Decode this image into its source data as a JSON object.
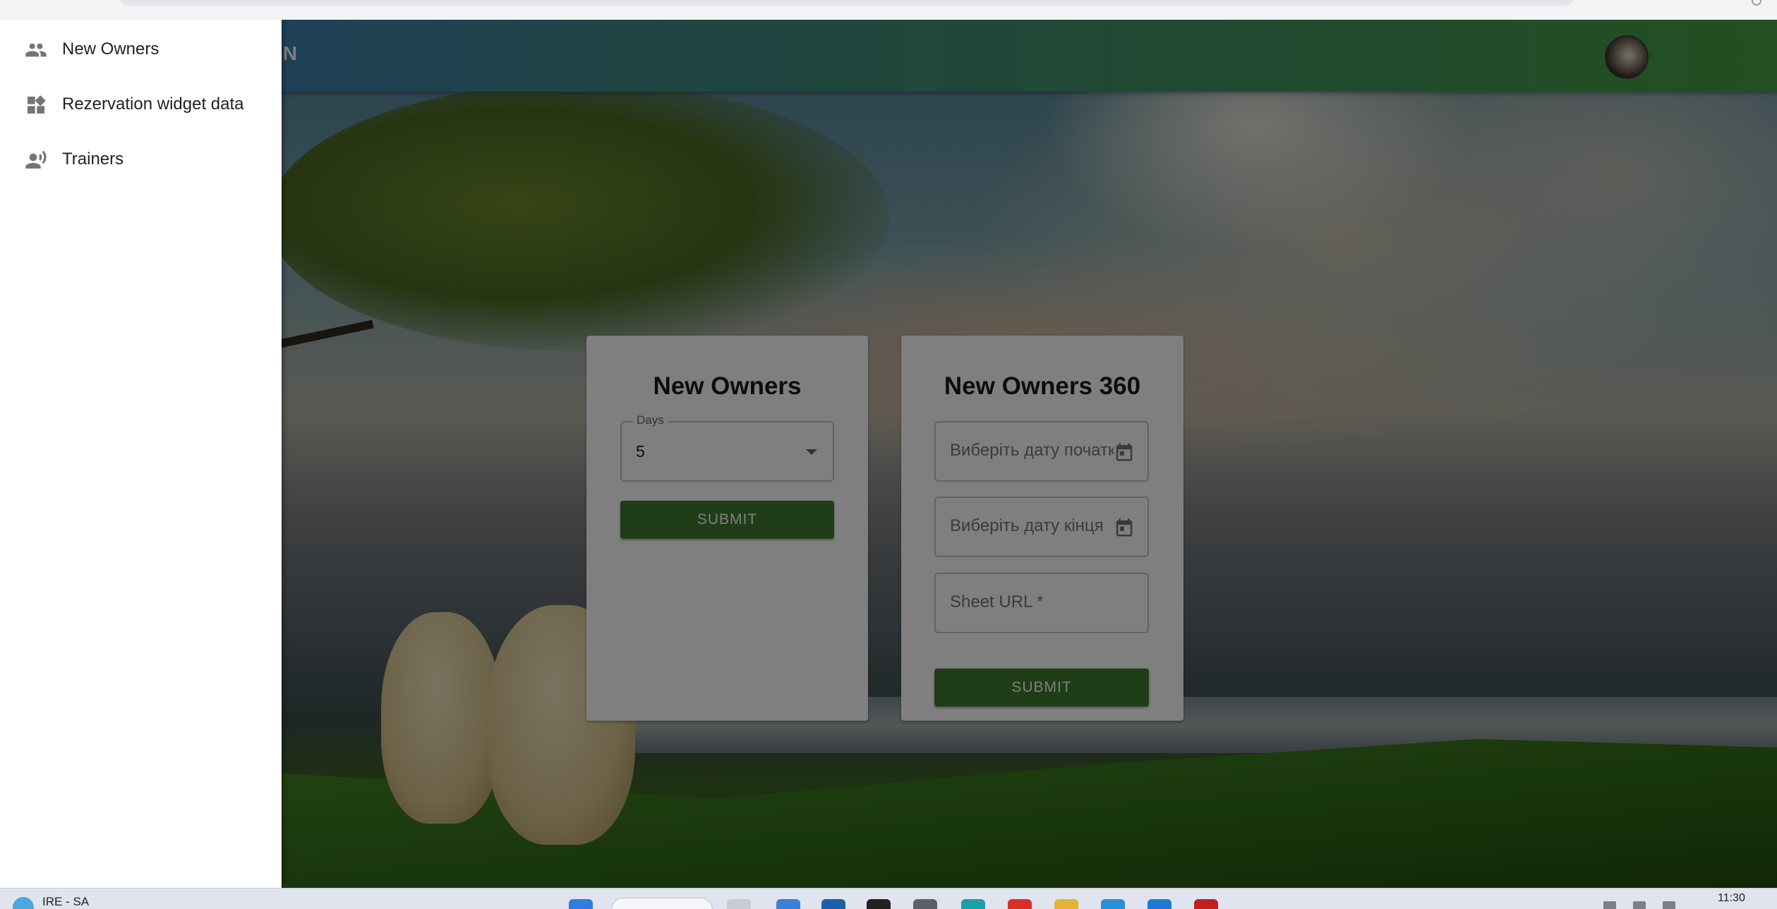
{
  "app": {
    "header_title_fragment": "ON"
  },
  "drawer": {
    "items": [
      {
        "label": "New Owners",
        "icon": "people-icon"
      },
      {
        "label": "Rezervation widget data",
        "icon": "dashboard-widgets-icon"
      },
      {
        "label": "Trainers",
        "icon": "record-voice-icon"
      }
    ]
  },
  "card_new_owners": {
    "title": "New Owners",
    "days_label": "Days",
    "days_value": "5",
    "submit_label": "SUBMIT"
  },
  "card_new_owners_360": {
    "title": "New Owners 360",
    "start_date_placeholder": "Виберіть дату початку",
    "end_date_placeholder": "Виберіть дату кінця",
    "sheet_url_placeholder": "Sheet URL *",
    "submit_label": "SUBMIT"
  },
  "taskbar": {
    "weather_text": "IRE - SA",
    "clock": "11:30"
  },
  "colors": {
    "header_gradient_start": "#3f7bd0",
    "header_gradient_end": "#45a040",
    "button_green": "#3f7d2e",
    "drawer_bg": "#ffffff"
  }
}
